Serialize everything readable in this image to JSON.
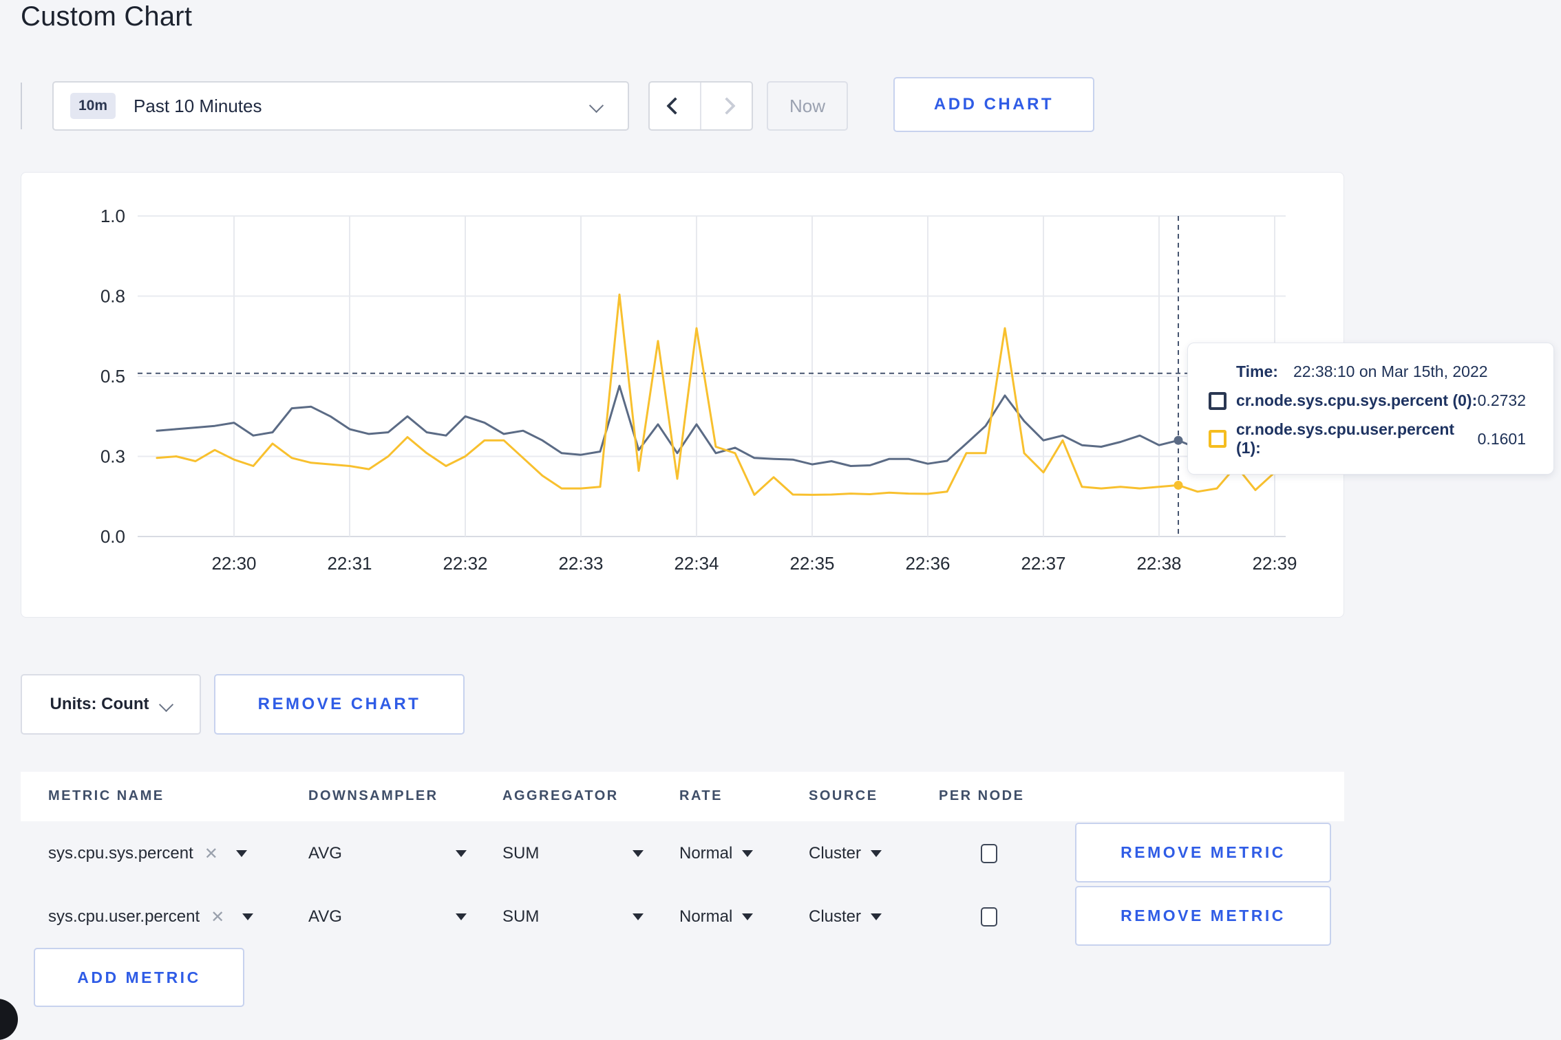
{
  "page": {
    "title": "Custom Chart"
  },
  "toolbar": {
    "range_badge": "10m",
    "range_label": "Past 10 Minutes",
    "now_label": "Now",
    "add_chart_label": "ADD CHART"
  },
  "chart_controls": {
    "units_label": "Units: Count",
    "remove_chart_label": "REMOVE CHART"
  },
  "tooltip": {
    "time_label": "Time:",
    "time_value": "22:38:10 on Mar 15th, 2022",
    "series": [
      {
        "label": "cr.node.sys.cpu.sys.percent (0):",
        "value": "0.2732",
        "color": "#2a3752"
      },
      {
        "label": "cr.node.sys.cpu.user.percent (1):",
        "value": "0.1601",
        "color": "#f5bd1f"
      }
    ]
  },
  "chart_data": {
    "type": "line",
    "title": "",
    "xlabel": "",
    "ylabel": "",
    "ylim": [
      0,
      1
    ],
    "grid": true,
    "x_axis_ticks": [
      "22:30",
      "22:31",
      "22:32",
      "22:33",
      "22:34",
      "22:35",
      "22:36",
      "22:37",
      "22:38",
      "22:39"
    ],
    "y_axis_tick_labels": [
      "0.0",
      "0.3",
      "0.5",
      "0.8",
      "1.0"
    ],
    "y_axis_tick_values": [
      0,
      0.25,
      0.5,
      0.75,
      1.0
    ],
    "x_start_time": "22:29:20",
    "x_interval_seconds": 10,
    "series": [
      {
        "name": "cr.node.sys.cpu.sys.percent",
        "color": "#5b6b85",
        "values": [
          0.33,
          0.335,
          0.34,
          0.345,
          0.355,
          0.315,
          0.325,
          0.4,
          0.405,
          0.375,
          0.335,
          0.32,
          0.325,
          0.375,
          0.325,
          0.315,
          0.375,
          0.355,
          0.32,
          0.33,
          0.3,
          0.26,
          0.255,
          0.265,
          0.47,
          0.27,
          0.35,
          0.26,
          0.35,
          0.26,
          0.277,
          0.245,
          0.242,
          0.24,
          0.225,
          0.235,
          0.22,
          0.222,
          0.242,
          0.242,
          0.227,
          0.236,
          0.29,
          0.345,
          0.44,
          0.36,
          0.3,
          0.315,
          0.285,
          0.28,
          0.295,
          0.315,
          0.285,
          0.3,
          0.275,
          0.26,
          0.27,
          0.265,
          0.295,
          0.305
        ]
      },
      {
        "name": "cr.node.sys.cpu.user.percent",
        "color": "#f8c02e",
        "values": [
          0.245,
          0.25,
          0.235,
          0.27,
          0.24,
          0.22,
          0.29,
          0.245,
          0.23,
          0.225,
          0.22,
          0.21,
          0.25,
          0.31,
          0.26,
          0.22,
          0.25,
          0.3,
          0.3,
          0.245,
          0.19,
          0.15,
          0.15,
          0.155,
          0.755,
          0.205,
          0.61,
          0.18,
          0.65,
          0.28,
          0.26,
          0.13,
          0.185,
          0.131,
          0.13,
          0.131,
          0.134,
          0.132,
          0.137,
          0.134,
          0.133,
          0.14,
          0.26,
          0.26,
          0.65,
          0.26,
          0.2,
          0.3,
          0.155,
          0.15,
          0.155,
          0.15,
          0.155,
          0.16,
          0.14,
          0.15,
          0.22,
          0.145,
          0.2,
          0.27
        ]
      }
    ],
    "crosshair": {
      "time": "22:38:10",
      "point_index": 53,
      "hover_y_value": 0.509
    },
    "legend_position": "tooltip-only"
  },
  "metrics_table": {
    "headers": [
      "METRIC NAME",
      "DOWNSAMPLER",
      "AGGREGATOR",
      "RATE",
      "SOURCE",
      "PER NODE"
    ],
    "rows": [
      {
        "metric": "sys.cpu.sys.percent",
        "downsampler": "AVG",
        "aggregator": "SUM",
        "rate": "Normal",
        "source": "Cluster",
        "per_node_checked": false,
        "remove_label": "REMOVE METRIC"
      },
      {
        "metric": "sys.cpu.user.percent",
        "downsampler": "AVG",
        "aggregator": "SUM",
        "rate": "Normal",
        "source": "Cluster",
        "per_node_checked": false,
        "remove_label": "REMOVE METRIC"
      }
    ],
    "add_metric_label": "ADD METRIC"
  }
}
